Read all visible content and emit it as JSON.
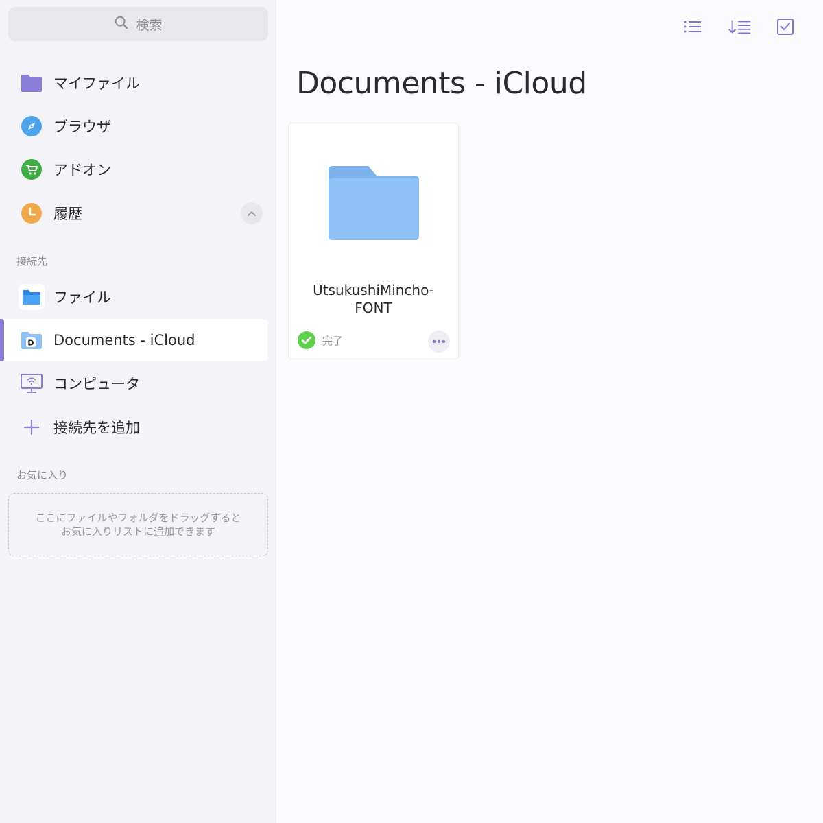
{
  "search": {
    "placeholder": "検索"
  },
  "sidebar": {
    "items": [
      {
        "label": "マイファイル",
        "icon": "folder-icon"
      },
      {
        "label": "ブラウザ",
        "icon": "compass-icon"
      },
      {
        "label": "アドオン",
        "icon": "cart-icon"
      },
      {
        "label": "履歴",
        "icon": "clock-icon"
      }
    ],
    "connections_header": "接続先",
    "connections": [
      {
        "label": "ファイル",
        "icon": "files-app-icon"
      },
      {
        "label": "Documents - iCloud",
        "icon": "documents-folder-icon",
        "active": true
      },
      {
        "label": "コンピュータ",
        "icon": "computer-icon"
      },
      {
        "label": "接続先を追加",
        "icon": "plus-icon"
      }
    ],
    "favorites_header": "お気に入り",
    "favorites_hint_line1": "ここにファイルやフォルダをドラッグすると",
    "favorites_hint_line2": "お気に入りリストに追加できます"
  },
  "main": {
    "title": "Documents - iCloud",
    "files": [
      {
        "name_line1": "UtsukushiMincho-",
        "name_line2": "FONT",
        "status": "完了"
      }
    ]
  },
  "colors": {
    "accent": "#8a7fd6",
    "folder": "#8fc1f7",
    "sync_ok": "#5ed14b"
  }
}
